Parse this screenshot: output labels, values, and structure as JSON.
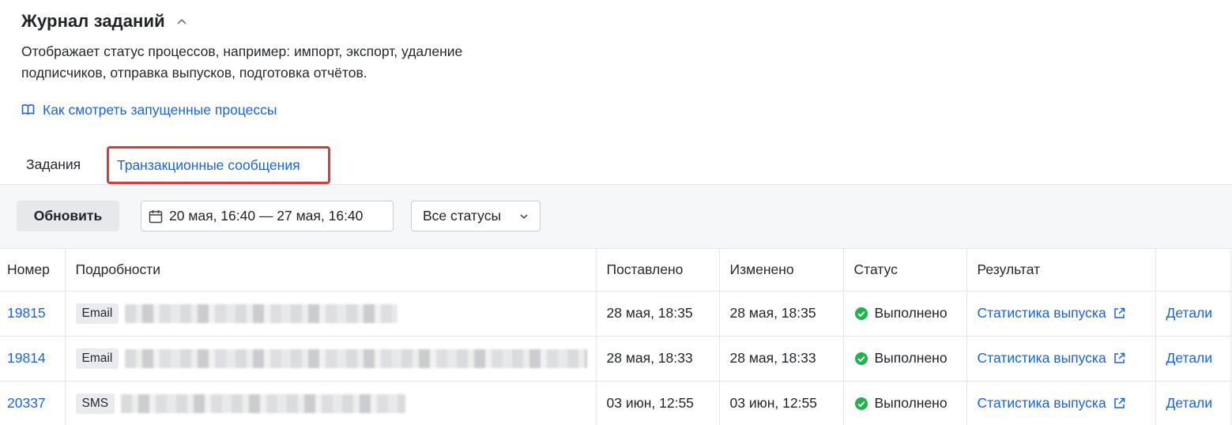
{
  "header": {
    "title": "Журнал заданий",
    "description_line1": "Отображает статус процессов, например: импорт, экспорт, удаление",
    "description_line2": "подписчиков, отправка выпусков, подготовка отчётов.",
    "help_link": "Как смотреть запущенные процессы"
  },
  "tabs": [
    {
      "label": "Задания",
      "active": false
    },
    {
      "label": "Транзакционные сообщения",
      "active": true
    }
  ],
  "toolbar": {
    "refresh_label": "Обновить",
    "date_range": "20 мая, 16:40 — 27 мая, 16:40",
    "status_filter": "Все статусы"
  },
  "table": {
    "columns": [
      "Номер",
      "Подробности",
      "Поставлено",
      "Изменено",
      "Статус",
      "Результат",
      ""
    ],
    "rows": [
      {
        "number": "19815",
        "channel": "Email",
        "placed": "28 мая, 18:35",
        "changed": "28 мая, 18:35",
        "status": "Выполнено",
        "result": "Статистика выпуска",
        "action": "Детали"
      },
      {
        "number": "19814",
        "channel": "Email",
        "placed": "28 мая, 18:33",
        "changed": "28 мая, 18:33",
        "status": "Выполнено",
        "result": "Статистика выпуска",
        "action": "Детали"
      },
      {
        "number": "20337",
        "channel": "SMS",
        "placed": "03 июн, 12:55",
        "changed": "03 июн, 12:55",
        "status": "Выполнено",
        "result": "Статистика выпуска",
        "action": "Детали"
      }
    ]
  },
  "colors": {
    "link": "#1d63d8",
    "success": "#22b24c",
    "highlight_border": "#d93b3b"
  },
  "icons": {
    "title_toggle": "chevron-up-icon",
    "help": "book-icon",
    "date": "calendar-icon",
    "select": "chevron-down-icon",
    "status_ok": "check-circle-icon",
    "result": "external-link-icon"
  }
}
